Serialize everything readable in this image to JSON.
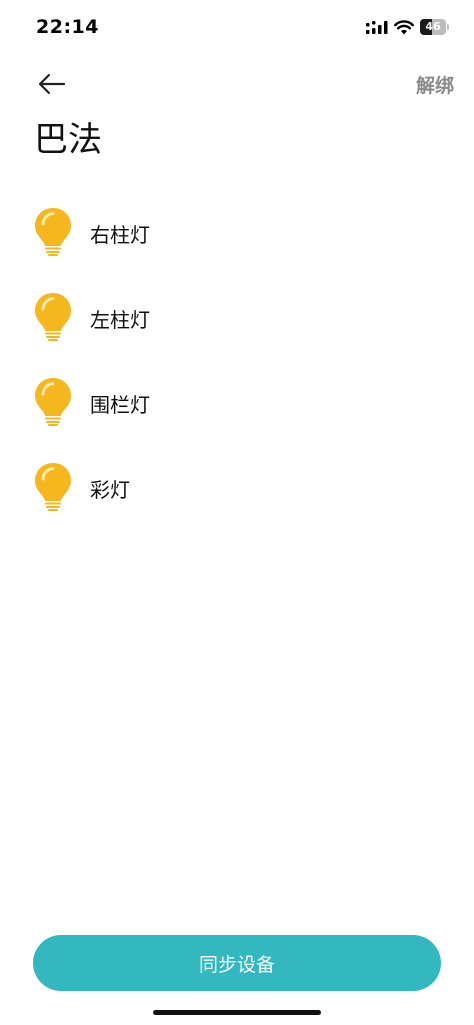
{
  "status_bar": {
    "time": "22:14",
    "battery_level": "46",
    "battery_fraction": 0.46
  },
  "header": {
    "back_icon": "arrow-left-icon",
    "unbind_label": "解绑",
    "title": "巴法"
  },
  "devices": [
    {
      "label": "右柱灯",
      "icon": "lightbulb-icon"
    },
    {
      "label": "左柱灯",
      "icon": "lightbulb-icon"
    },
    {
      "label": "围栏灯",
      "icon": "lightbulb-icon"
    },
    {
      "label": "彩灯",
      "icon": "lightbulb-icon"
    }
  ],
  "actions": {
    "sync_label": "同步设备"
  },
  "colors": {
    "accent": "#33b8bf",
    "bulb": "#f5b71e",
    "bulb_highlight": "#fde9a8",
    "muted_text": "#8a8a8a"
  }
}
